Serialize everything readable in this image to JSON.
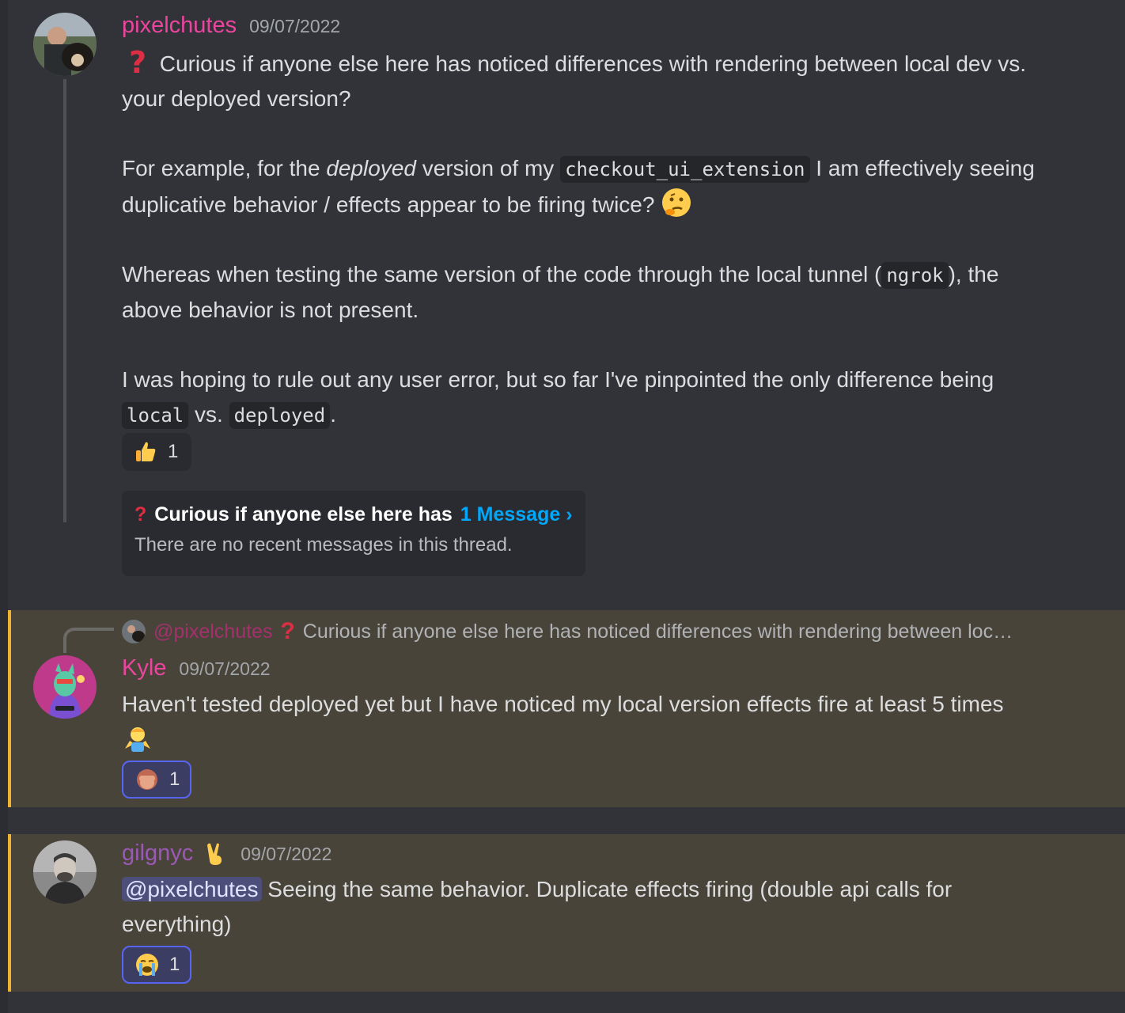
{
  "messages": [
    {
      "author": "pixelchutes",
      "author_color": "#eb459e",
      "timestamp": "09/07/2022",
      "paragraphs": {
        "p1_emoji": "question-mark-emoji",
        "p1_text": "Curious if anyone else here has noticed differences with rendering between local dev vs. your deployed version?",
        "p2_a": "For example, for the ",
        "p2_em": "deployed",
        "p2_b": " version of my ",
        "p2_code": "checkout_ui_extension",
        "p2_c": " I am effectively seeing duplicative behavior / effects appear to be firing twice?",
        "p3_a": "Whereas when testing the same version of the code through the local tunnel (",
        "p3_code": "ngrok",
        "p3_b": "), the above behavior is not present.",
        "p4_a": "I was hoping to rule out any user error, but so far I've pinpointed the only difference being ",
        "p4_code1": "local",
        "p4_mid": " vs. ",
        "p4_code2": "deployed",
        "p4_end": "."
      },
      "reaction": {
        "emoji": "thumbs-up",
        "count": "1"
      },
      "thread": {
        "title": "Curious if anyone else here has",
        "count": "1 Message ›",
        "subtitle": "There are no recent messages in this thread."
      }
    },
    {
      "reply": {
        "author": "@pixelchutes",
        "text": "Curious if anyone else here has noticed differences with rendering between loc…"
      },
      "author": "Kyle",
      "author_color": "#eb459e",
      "timestamp": "09/07/2022",
      "text": "Haven't tested deployed yet but I have noticed my local version effects fire at least 5 times",
      "reaction": {
        "emoji": "see-no-evil-monkey",
        "count": "1"
      }
    },
    {
      "author": "gilgnyc",
      "author_badge": "victory-hand",
      "author_color": "#9b59b6",
      "timestamp": "09/07/2022",
      "mention": "@pixelchutes",
      "text": " Seeing the same behavior. Duplicate effects firing (double api calls for everything)",
      "reaction": {
        "emoji": "loudly-crying-face",
        "count": "1"
      }
    }
  ],
  "colors": {
    "background": "#323339",
    "highlight_bg": "#49443a",
    "highlight_border": "#f0b232",
    "link": "#00a8fc",
    "mention_bg": "#4d4f7a"
  }
}
